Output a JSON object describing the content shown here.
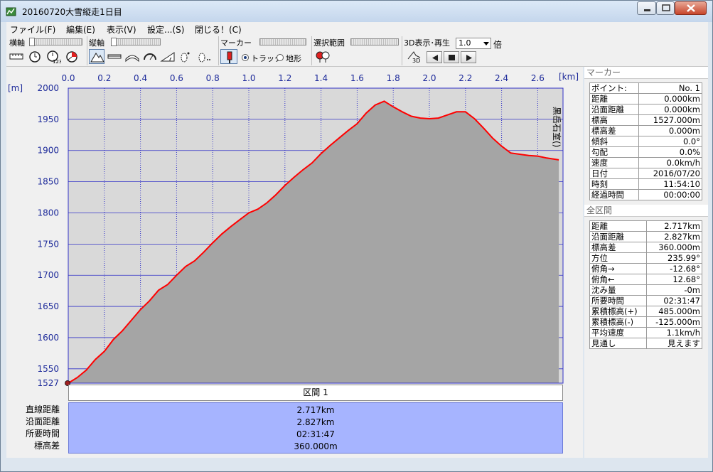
{
  "window": {
    "title": "20160720大雪縦走1日目"
  },
  "menu": [
    "ファイル(F)",
    "編集(E)",
    "表示(V)",
    "設定...(S)",
    "閉じる！(C)"
  ],
  "toolbar": {
    "h_axis_label": "横軸",
    "v_axis_label": "縦軸",
    "marker_label": "マーカー",
    "radio_track": "トラック",
    "radio_terrain": "地形",
    "range_label": "選択範囲",
    "playback_label": "3D表示･再生",
    "speed_value": "1.0",
    "speed_unit": "倍"
  },
  "chart_data": {
    "type": "area",
    "xlabel": "[km]",
    "ylabel": "[m]",
    "xlim": [
      0,
      2.717
    ],
    "ylim": [
      1527,
      2000
    ],
    "x_ticks": [
      "0.0",
      "0.2",
      "0.4",
      "0.6",
      "0.8",
      "1.0",
      "1.2",
      "1.4",
      "1.6",
      "1.8",
      "2.0",
      "2.2",
      "2.4",
      "2.6"
    ],
    "y_ticks": [
      "2000",
      "1950",
      "1900",
      "1850",
      "1800",
      "1750",
      "1700",
      "1650",
      "1600",
      "1550",
      "1527"
    ],
    "annotation": "黒岳石室()",
    "line_color": "#ff0000",
    "fill_color": "#a5a5a5",
    "grid_color": "#3232c8",
    "points": [
      [
        0.0,
        1527
      ],
      [
        0.05,
        1536
      ],
      [
        0.1,
        1548
      ],
      [
        0.15,
        1565
      ],
      [
        0.2,
        1578
      ],
      [
        0.25,
        1597
      ],
      [
        0.3,
        1611
      ],
      [
        0.35,
        1628
      ],
      [
        0.4,
        1645
      ],
      [
        0.45,
        1659
      ],
      [
        0.5,
        1676
      ],
      [
        0.55,
        1685
      ],
      [
        0.6,
        1700
      ],
      [
        0.65,
        1714
      ],
      [
        0.7,
        1723
      ],
      [
        0.75,
        1737
      ],
      [
        0.8,
        1752
      ],
      [
        0.85,
        1766
      ],
      [
        0.9,
        1778
      ],
      [
        0.95,
        1789
      ],
      [
        1.0,
        1800
      ],
      [
        1.05,
        1806
      ],
      [
        1.1,
        1816
      ],
      [
        1.15,
        1829
      ],
      [
        1.2,
        1844
      ],
      [
        1.25,
        1857
      ],
      [
        1.3,
        1869
      ],
      [
        1.35,
        1880
      ],
      [
        1.4,
        1895
      ],
      [
        1.45,
        1908
      ],
      [
        1.5,
        1920
      ],
      [
        1.55,
        1932
      ],
      [
        1.6,
        1943
      ],
      [
        1.65,
        1960
      ],
      [
        1.7,
        1973
      ],
      [
        1.75,
        1979
      ],
      [
        1.8,
        1970
      ],
      [
        1.85,
        1962
      ],
      [
        1.9,
        1955
      ],
      [
        1.95,
        1952
      ],
      [
        2.0,
        1951
      ],
      [
        2.05,
        1952
      ],
      [
        2.1,
        1957
      ],
      [
        2.15,
        1962
      ],
      [
        2.2,
        1962
      ],
      [
        2.25,
        1951
      ],
      [
        2.3,
        1936
      ],
      [
        2.35,
        1920
      ],
      [
        2.4,
        1907
      ],
      [
        2.45,
        1896
      ],
      [
        2.5,
        1894
      ],
      [
        2.55,
        1892
      ],
      [
        2.6,
        1891
      ],
      [
        2.65,
        1888
      ],
      [
        2.717,
        1885
      ]
    ]
  },
  "section": {
    "header": "区間 1",
    "row_labels": [
      "直線距離",
      "沿面距離",
      "所要時間",
      "標高差"
    ],
    "row_values": [
      "2.717km",
      "2.827km",
      "02:31:47",
      "360.000m"
    ]
  },
  "marker_panel": {
    "header": "マーカー",
    "rows": [
      [
        "ポイント:",
        "No. 1"
      ],
      [
        "距離",
        "0.000km"
      ],
      [
        "沿面距離",
        "0.000km"
      ],
      [
        "標高",
        "1527.000m"
      ],
      [
        "標高差",
        "0.000m"
      ],
      [
        "傾斜",
        "0.0°"
      ],
      [
        "勾配",
        "0.0%"
      ],
      [
        "速度",
        "0.0km/h"
      ],
      [
        "日付",
        "2016/07/20"
      ],
      [
        "時刻",
        "11:54:10"
      ],
      [
        "経過時間",
        "00:00:00"
      ]
    ]
  },
  "total_panel": {
    "header": "全区間",
    "rows": [
      [
        "距離",
        "2.717km"
      ],
      [
        "沿面距離",
        "2.827km"
      ],
      [
        "標高差",
        "360.000m"
      ],
      [
        "方位",
        "235.99°"
      ],
      [
        "俯角→",
        "-12.68°"
      ],
      [
        "俯角←",
        "12.68°"
      ],
      [
        "沈み量",
        "-0m"
      ],
      [
        "所要時間",
        "02:31:47"
      ],
      [
        "累積標高(+)",
        "485.000m"
      ],
      [
        "累積標高(-)",
        "-125.000m"
      ],
      [
        "平均速度",
        "1.1km/h"
      ],
      [
        "見通し",
        "見えます"
      ]
    ]
  }
}
